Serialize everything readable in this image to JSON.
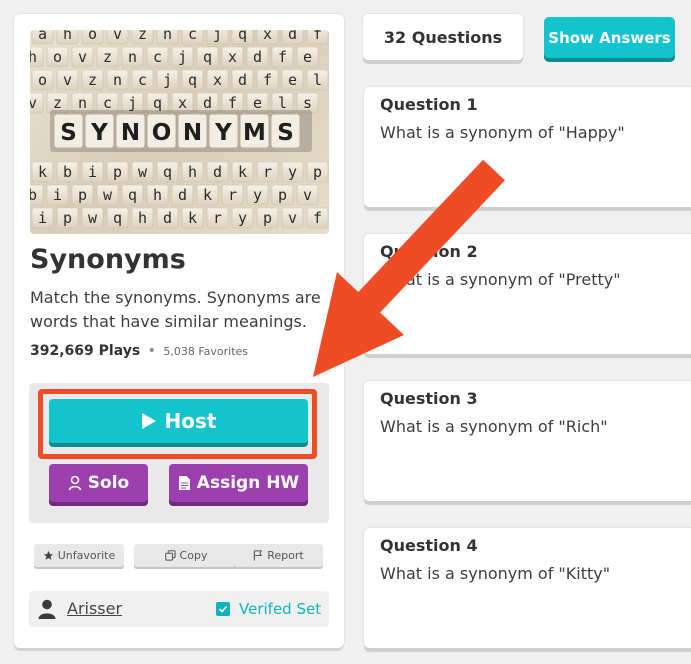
{
  "set": {
    "cover_word": "SYNONYMS",
    "title": "Synonyms",
    "description": "Match the synonyms. Synonyms are words that have similar meanings.",
    "plays": "392,669 Plays",
    "separator": "•",
    "favorites": "5,038 Favorites",
    "author": "Arisser",
    "verified_label": "Verifed Set"
  },
  "actions": {
    "host_label": "Host",
    "solo_label": "Solo",
    "assign_hw_label": "Assign HW",
    "unfavorite_label": "Unfavorite",
    "copy_label": "Copy",
    "report_label": "Report"
  },
  "toolbar": {
    "question_count": "32 Questions",
    "show_answers_label": "Show Answers"
  },
  "questions": [
    {
      "label": "Question 1",
      "text": "What is a synonym of \"Happy\""
    },
    {
      "label": "Question 2",
      "text": "What is a synonym of \"Pretty\""
    },
    {
      "label": "Question 3",
      "text": "What is a synonym of \"Rich\""
    },
    {
      "label": "Question 4",
      "text": "What is a synonym of \"Kitty\""
    }
  ],
  "colors": {
    "accent_teal": "#13c4cc",
    "purple": "#9c3faf",
    "annotation_red": "#ef4b24"
  },
  "icons": {
    "host": "play-icon",
    "solo": "person-icon",
    "assign_hw": "document-icon",
    "unfavorite": "star-icon",
    "copy": "copy-icon",
    "report": "flag-icon",
    "author": "user-icon",
    "verified": "checkbox-icon"
  }
}
